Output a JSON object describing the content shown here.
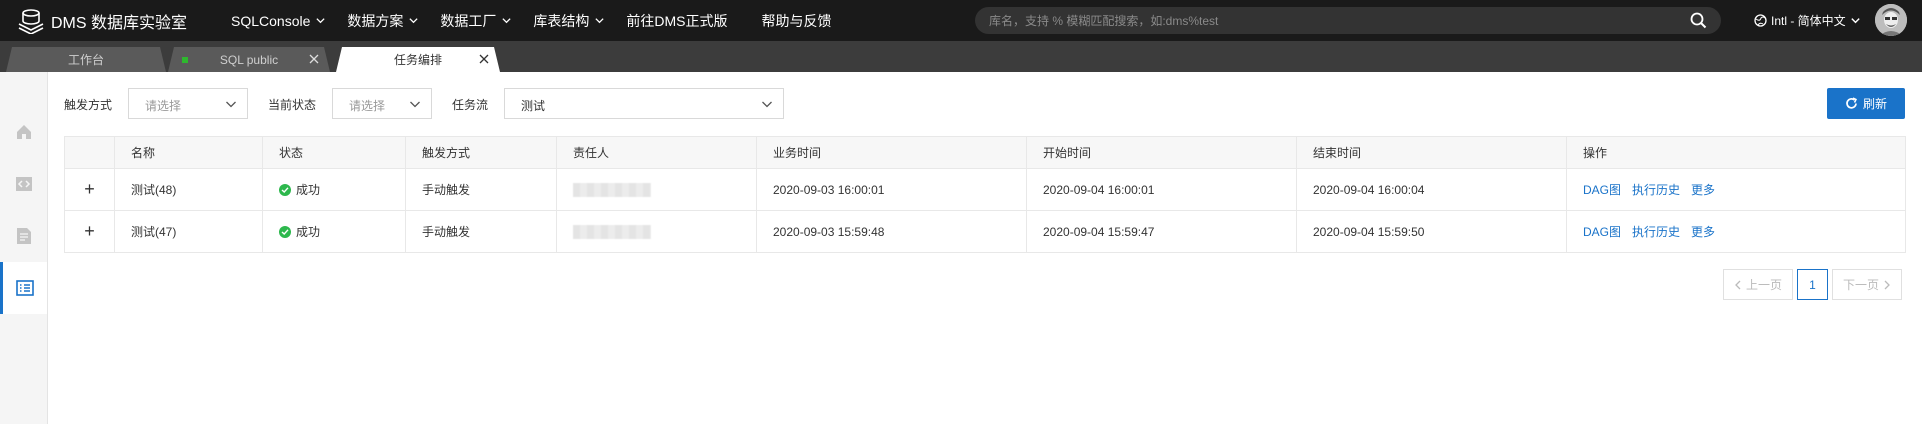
{
  "app": {
    "title": "DMS 数据库实验室"
  },
  "nav": [
    {
      "label": "SQLConsole",
      "has_menu": true
    },
    {
      "label": "数据方案",
      "has_menu": true
    },
    {
      "label": "数据工厂",
      "has_menu": true
    },
    {
      "label": "库表结构",
      "has_menu": true
    },
    {
      "label": "前往DMS正式版",
      "has_menu": false
    },
    {
      "label": "帮助与反馈",
      "has_menu": false
    }
  ],
  "search": {
    "placeholder": "库名，支持 % 模糊匹配搜索，如:dms%test"
  },
  "lang": {
    "label": "Intl - 简体中文"
  },
  "tabs": [
    {
      "label": "工作台",
      "closable": false
    },
    {
      "label": "SQL public",
      "closable": true
    },
    {
      "label": "任务编排",
      "closable": true,
      "active": true
    }
  ],
  "filters": {
    "trigger": {
      "label": "触发方式",
      "placeholder": "请选择"
    },
    "status": {
      "label": "当前状态",
      "placeholder": "请选择"
    },
    "flow": {
      "label": "任务流",
      "value": "测试"
    }
  },
  "refresh_label": "刷新",
  "table": {
    "columns": [
      "名称",
      "状态",
      "触发方式",
      "责任人",
      "业务时间",
      "开始时间",
      "结束时间",
      "操作"
    ],
    "rows": [
      {
        "expand": "+",
        "name": "测试(48)",
        "status": "成功",
        "trigger": "手动触发",
        "biz_time": "2020-09-03 16:00:01",
        "start_time": "2020-09-04 16:00:01",
        "end_time": "2020-09-04 16:00:04"
      },
      {
        "expand": "+",
        "name": "测试(47)",
        "status": "成功",
        "trigger": "手动触发",
        "biz_time": "2020-09-03 15:59:48",
        "start_time": "2020-09-04 15:59:47",
        "end_time": "2020-09-04 15:59:50"
      }
    ],
    "actions": [
      "DAG图",
      "执行历史",
      "更多"
    ]
  },
  "pagination": {
    "prev": "上一页",
    "current": "1",
    "next": "下一页"
  },
  "colors": {
    "accent": "#1a73c9",
    "topbar": "#1a1a1a",
    "tabbar": "#3c3c3c",
    "success": "#2db84d"
  }
}
